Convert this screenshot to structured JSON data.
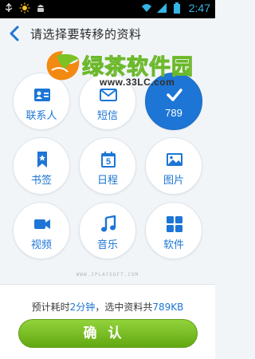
{
  "status_bar": {
    "time": "2:47",
    "left_icons": [
      "usb-icon",
      "sun-icon",
      "android-icon"
    ],
    "right_icons": [
      "wifi-icon",
      "signal-icon",
      "battery-icon"
    ]
  },
  "header": {
    "title": "请选择要转移的资料"
  },
  "watermark": {
    "text": "绿茶软件园",
    "url": "www.33LC.com"
  },
  "items": [
    {
      "label": "联系人",
      "icon": "contact-card-icon",
      "selected": false
    },
    {
      "label": "短信",
      "icon": "envelope-icon",
      "selected": false
    },
    {
      "label": "789",
      "icon": "checkmark-icon",
      "selected": true
    },
    {
      "label": "书签",
      "icon": "bookmark-icon",
      "selected": false
    },
    {
      "label": "日程",
      "icon": "calendar-icon",
      "selected": false,
      "icon_text": "5"
    },
    {
      "label": "图片",
      "icon": "picture-icon",
      "selected": false
    },
    {
      "label": "视频",
      "icon": "video-camera-icon",
      "selected": false
    },
    {
      "label": "音乐",
      "icon": "music-note-icon",
      "selected": false
    },
    {
      "label": "软件",
      "icon": "apps-grid-icon",
      "selected": false
    }
  ],
  "credit": "WWW.IPLAYSOFT.COM",
  "summary": {
    "prefix": "预计耗时",
    "time_value": "2分钟",
    "middle": "，选中资料共",
    "size_value": "789KB"
  },
  "confirm_label": "确认",
  "colors": {
    "accent_blue": "#1d76d5",
    "button_green": "#7cc226",
    "background": "#f2f5f8"
  }
}
